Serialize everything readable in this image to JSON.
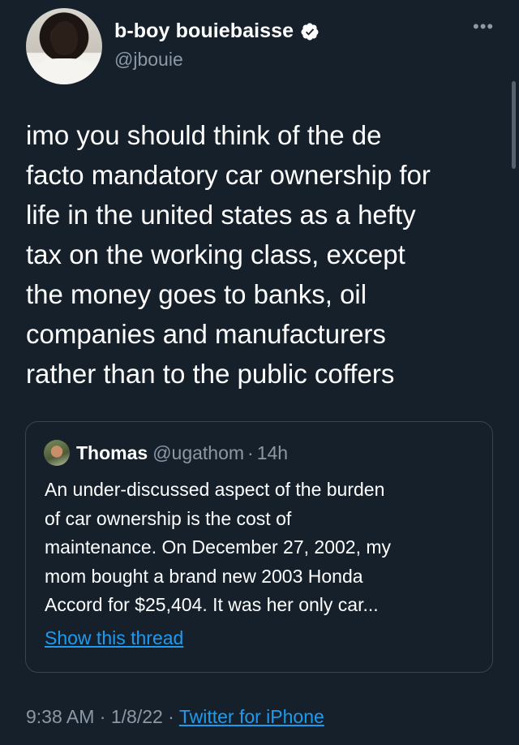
{
  "author": {
    "display_name": "b-boy bouiebaisse",
    "handle": "@jbouie",
    "verified": true,
    "verified_icon": "verified-badge-icon",
    "more_icon": "more-options-icon"
  },
  "tweet": {
    "lines": [
      "imo you should think of the de",
      "facto mandatory car ownership for",
      "life in the united states as a hefty",
      "tax on the working class, except",
      "the money goes to banks, oil",
      "companies and manufacturers",
      "rather than to the public coffers"
    ]
  },
  "quote": {
    "name": "Thomas",
    "handle": "@ugathom",
    "separator": "·",
    "time": "14h",
    "lines": [
      "An under-discussed aspect of the burden",
      "of car ownership is the cost of",
      "maintenance. On December 27, 2002, my",
      "mom bought a brand new 2003 Honda",
      "Accord for $25,404. It was her only car..."
    ],
    "show_thread": "Show this thread"
  },
  "meta": {
    "time": "9:38 AM",
    "sep1": " · ",
    "date": "1/8/22",
    "sep2": " · ",
    "source": "Twitter for iPhone"
  },
  "colors": {
    "background": "#15202b",
    "text": "#ffffff",
    "secondary": "#8b98a5",
    "link": "#1d9bf0",
    "border": "#38444d"
  }
}
